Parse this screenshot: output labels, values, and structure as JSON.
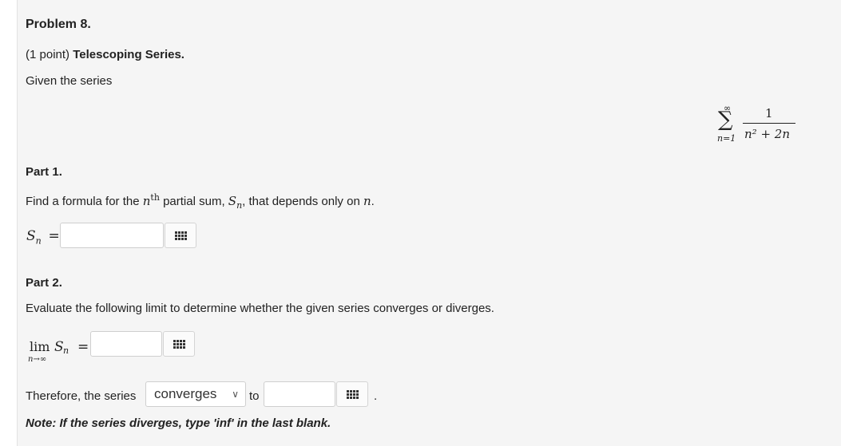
{
  "problem": {
    "title": "Problem 8.",
    "points": "(1 point)",
    "topic": "Telescoping Series.",
    "given": "Given the series"
  },
  "series": {
    "upper": "∞",
    "lower": "n=1",
    "numerator": "1",
    "denominator": "n² + 2n"
  },
  "part1": {
    "heading": "Part 1.",
    "prompt_a": "Find a formula for the ",
    "prompt_n": "n",
    "prompt_th": "th",
    "prompt_b": " partial sum, ",
    "prompt_S": "S",
    "prompt_sub": "n",
    "prompt_c": ", that depends only on ",
    "prompt_d": "n",
    "prompt_e": ".",
    "label_S": "S",
    "label_sub": "n",
    "label_eq": "=",
    "answer": ""
  },
  "part2": {
    "heading": "Part 2.",
    "prompt": "Evaluate the following limit to determine whether the given series converges or diverges.",
    "lim": "lim",
    "lim_sub": "n→∞",
    "label_S": "S",
    "label_sub": "n",
    "label_eq": "=",
    "answer": ""
  },
  "conclusion": {
    "prefix": "Therefore, the series",
    "selected": "converges",
    "to": "to",
    "answer": "",
    "period": "."
  },
  "note": "Note: If the series diverges, type 'inf' in the last blank."
}
